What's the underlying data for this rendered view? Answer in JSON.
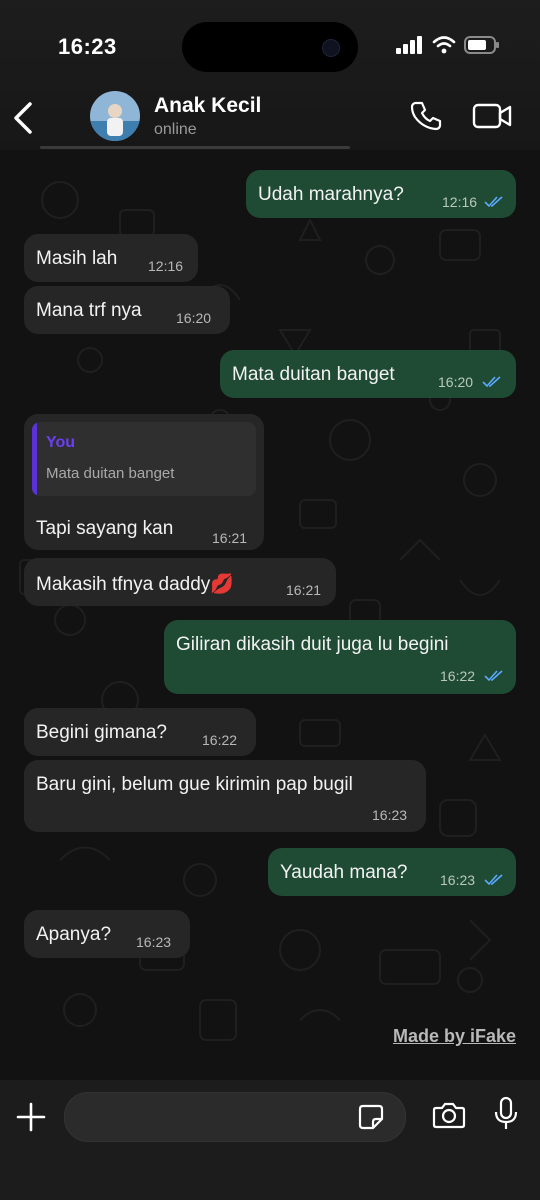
{
  "status_bar": {
    "time": "16:23"
  },
  "header": {
    "contact_name": "Anak Kecil",
    "contact_status": "online",
    "icons": [
      "back-chevron-icon",
      "phone-icon",
      "video-icon"
    ]
  },
  "messages": [
    {
      "dir": "out",
      "text": "Udah marahnya?",
      "time": "12:16",
      "read": true
    },
    {
      "dir": "in",
      "text": "Masih lah",
      "time": "12:16"
    },
    {
      "dir": "in",
      "text": "Mana trf nya",
      "time": "16:20"
    },
    {
      "dir": "out",
      "text": "Mata duitan banget",
      "time": "16:20",
      "read": true
    },
    {
      "dir": "in",
      "quote_author": "You",
      "quote_text": "Mata duitan banget",
      "text": "Tapi sayang kan",
      "time": "16:21"
    },
    {
      "dir": "in",
      "text": "Makasih tfnya daddy💋",
      "time": "16:21"
    },
    {
      "dir": "out",
      "text": "Giliran dikasih duit juga lu begini",
      "time": "16:22",
      "read": true
    },
    {
      "dir": "in",
      "text": "Begini gimana?",
      "time": "16:22"
    },
    {
      "dir": "in",
      "text": "Baru gini, belum gue kirimin pap bugil",
      "time": "16:23"
    },
    {
      "dir": "out",
      "text": "Yaudah mana?",
      "time": "16:23",
      "read": true
    },
    {
      "dir": "in",
      "text": "Apanya?",
      "time": "16:23"
    }
  ],
  "watermark": "Made by iFake",
  "composer": {
    "icons": [
      "plus-icon",
      "sticker-icon",
      "camera-icon",
      "microphone-icon"
    ]
  },
  "colors": {
    "outgoing_bubble": "#1f4a34",
    "incoming_bubble": "#262626",
    "read_ticks": "#5aa9ff",
    "quote_accent": "#5b32d8"
  }
}
